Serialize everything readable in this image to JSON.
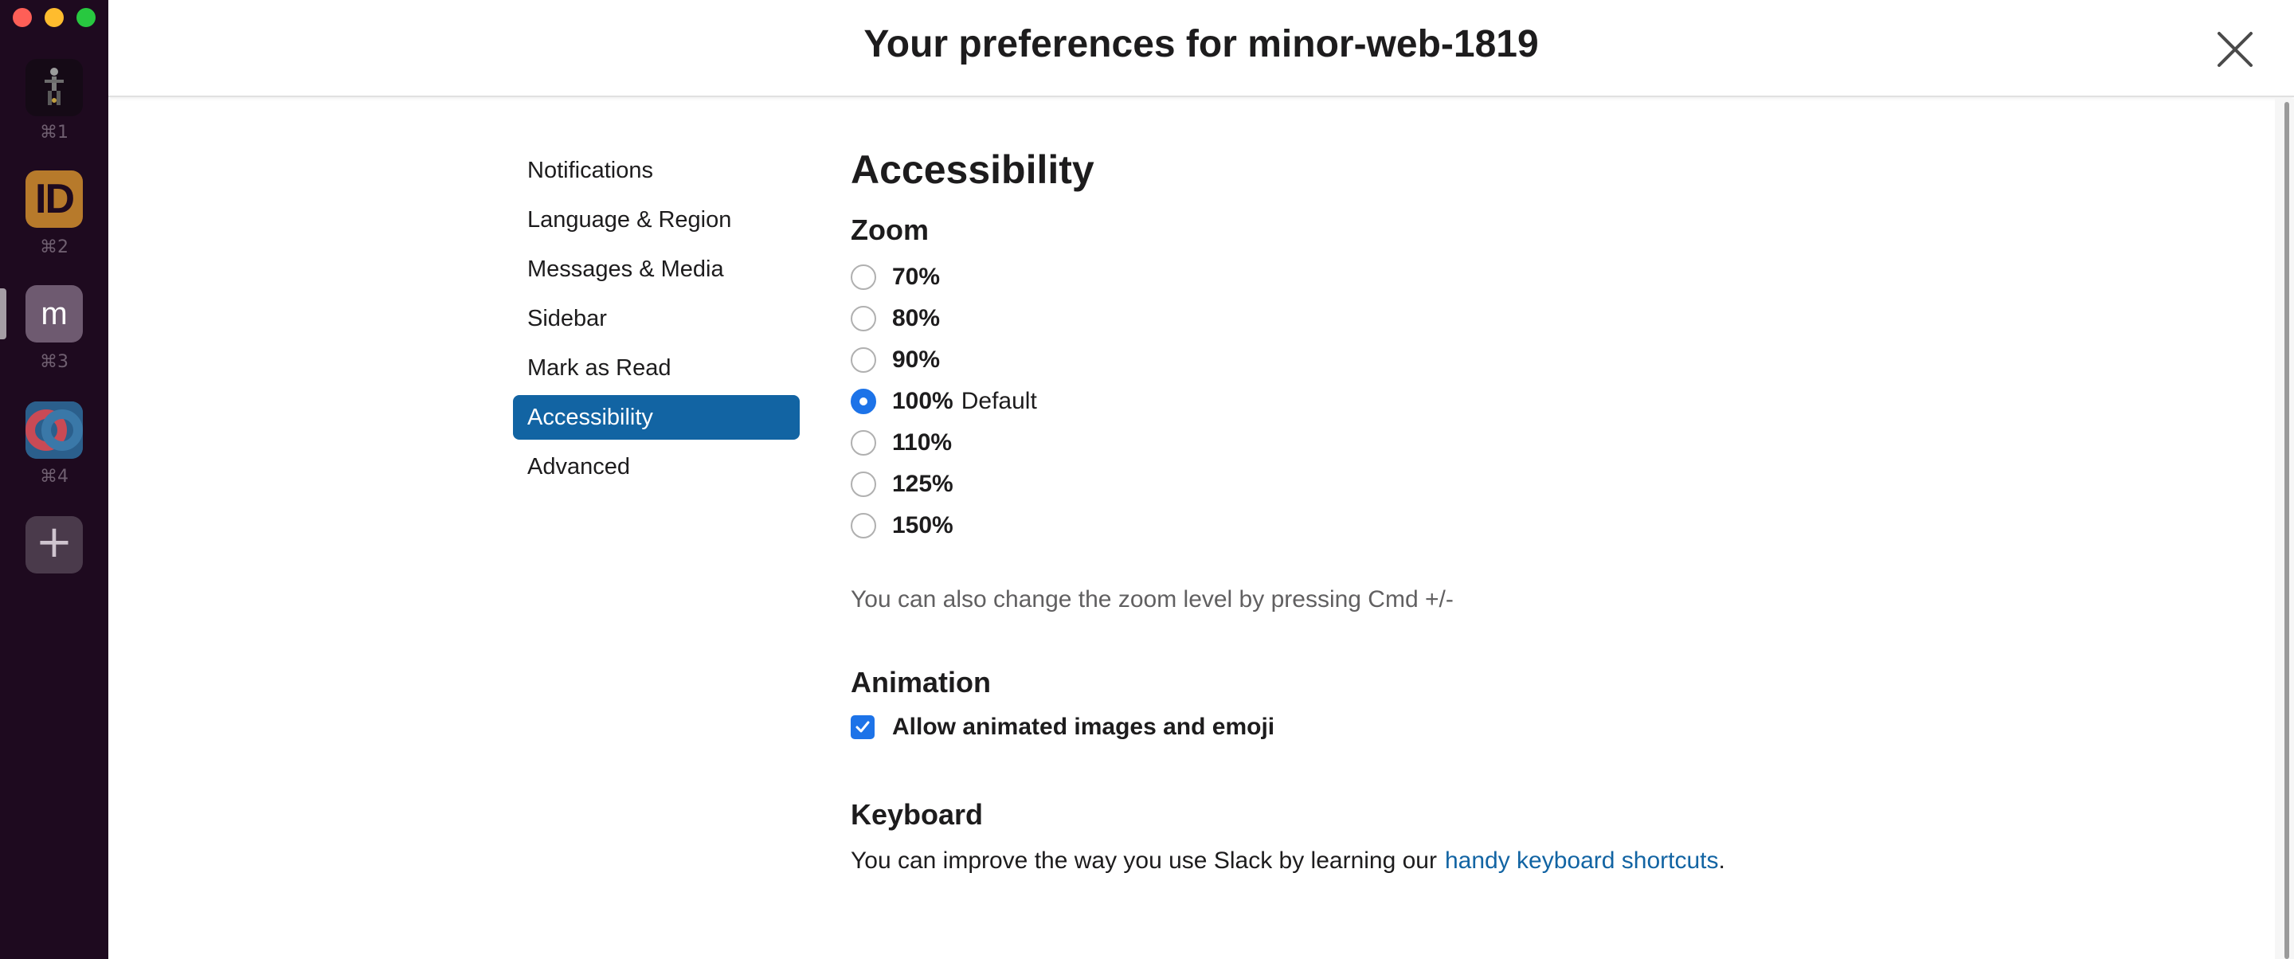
{
  "window": {
    "controls": [
      "close",
      "minimize",
      "zoom"
    ]
  },
  "workspaces": [
    {
      "name": "workspace-1",
      "shortcut": "⌘1",
      "icon": "figure-icon"
    },
    {
      "name": "workspace-2",
      "initials": "ID",
      "shortcut": "⌘2"
    },
    {
      "name": "workspace-3",
      "initials": "m",
      "shortcut": "⌘3"
    },
    {
      "name": "workspace-4",
      "shortcut": "⌘4",
      "icon": "rings-icon"
    }
  ],
  "header": {
    "title": "Your preferences for minor-web-1819"
  },
  "nav": {
    "items": [
      "Notifications",
      "Language & Region",
      "Messages & Media",
      "Sidebar",
      "Mark as Read",
      "Accessibility",
      "Advanced"
    ],
    "active": "Accessibility"
  },
  "content": {
    "title": "Accessibility",
    "zoom": {
      "title": "Zoom",
      "options": [
        {
          "label": "70%",
          "suffix": ""
        },
        {
          "label": "80%",
          "suffix": ""
        },
        {
          "label": "90%",
          "suffix": ""
        },
        {
          "label": "100%",
          "suffix": "Default"
        },
        {
          "label": "110%",
          "suffix": ""
        },
        {
          "label": "125%",
          "suffix": ""
        },
        {
          "label": "150%",
          "suffix": ""
        }
      ],
      "selected": "100%",
      "hint": "You can also change the zoom level by pressing Cmd +/-"
    },
    "animation": {
      "title": "Animation",
      "checkbox_label": "Allow animated images and emoji",
      "checked": true
    },
    "keyboard": {
      "title": "Keyboard",
      "text": "You can improve the way you use Slack by learning our",
      "link": "handy keyboard shortcuts",
      "suffix": "."
    }
  },
  "colors": {
    "accent": "#1264a3",
    "radio_checked": "#1d73e8",
    "rail": "#1e0a1f"
  }
}
